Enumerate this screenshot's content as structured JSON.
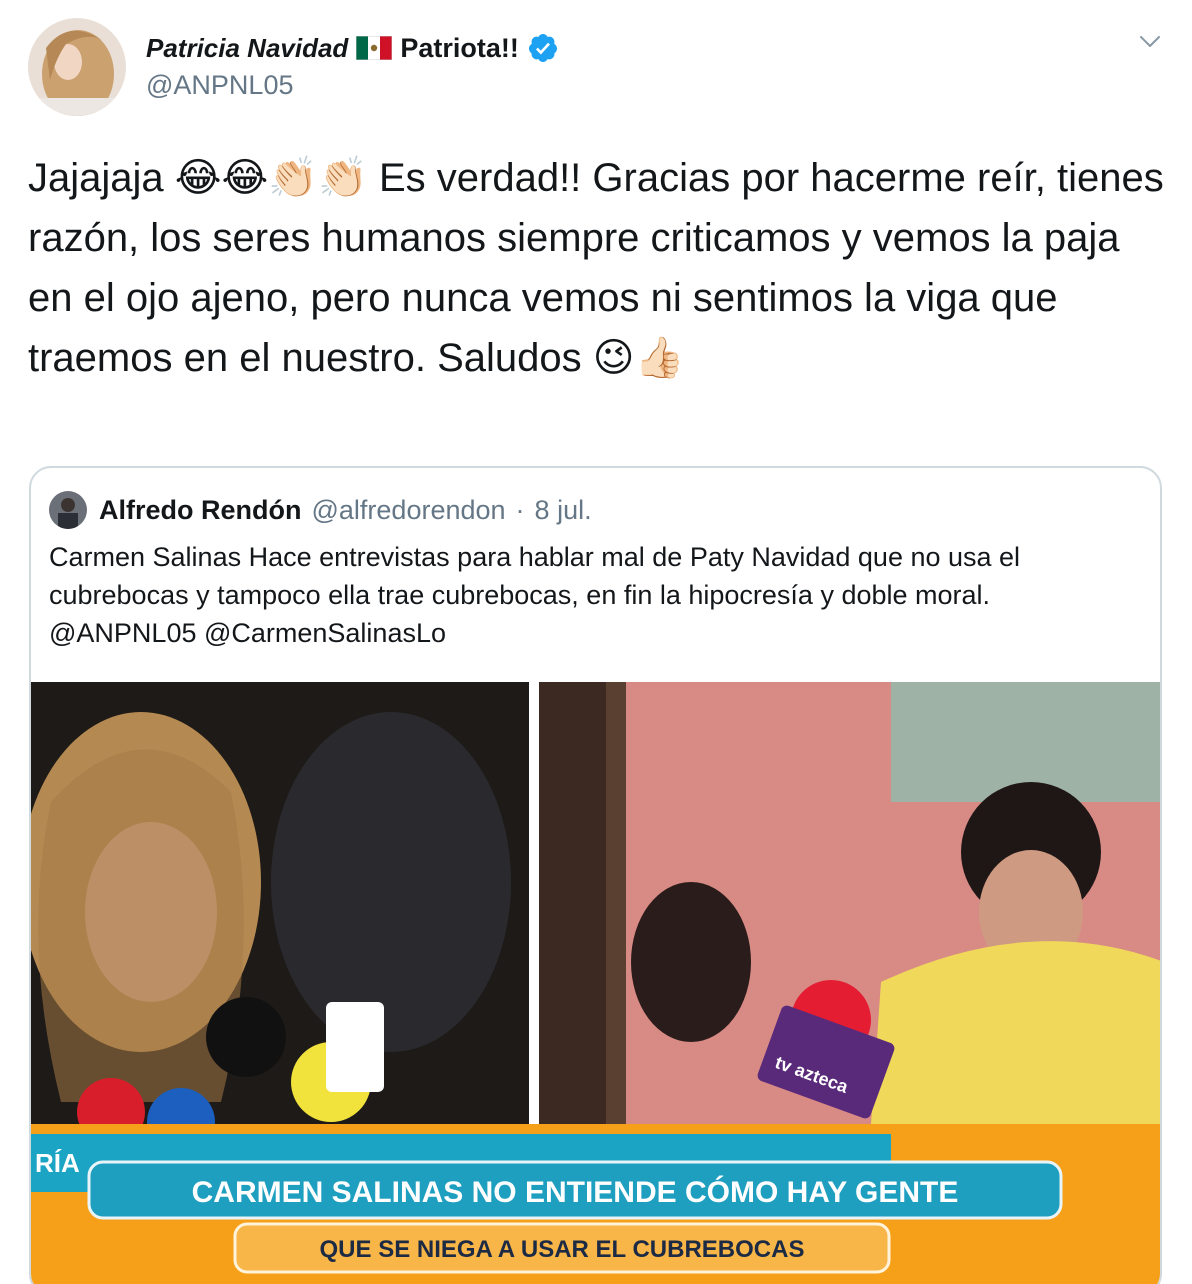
{
  "author": {
    "display_name": "Patricia Navidad",
    "display_name_suffix": "Patriota!!",
    "handle": "@ANPNL05",
    "verified": true,
    "flag": "mexico-flag"
  },
  "tweet": {
    "text_parts": {
      "p1": "Jajajaja ",
      "emojis1": "😂😂👏🏻👏🏻",
      "p2": " Es verdad!! Gracias por hacerme reír, tienes razón, los seres humanos siempre criticamos y vemos la paja en el ojo ajeno, pero nunca vemos ni sentimos la viga que traemos en el nuestro. Saludos ",
      "emojis2": "😉👍🏻"
    }
  },
  "quoted_tweet": {
    "author_name": "Alfredo Rendón",
    "author_handle": "@alfredorendon",
    "separator": "·",
    "date": "8 jul.",
    "text": "Carmen Salinas Hace entrevistas para hablar mal de Paty Navidad que no usa el cubrebocas y tampoco ella trae cubrebocas, en fin la hipocresía y doble moral. @ANPNL05 @CarmenSalinasLo",
    "media": {
      "banner_main": "CARMEN SALINAS NO ENTIENDE CÓMO HAY GENTE",
      "banner_sub": "QUE SE NIEGA A USAR EL CUBREBOCAS",
      "corner_label": "RÍA",
      "logo_text": "tv azteca"
    }
  },
  "colors": {
    "text": "#14171a",
    "secondary": "#657786",
    "verified": "#1da1f2",
    "border": "#cfd9de",
    "banner_orange": "#f6a01a",
    "banner_teal": "#19a6c6"
  }
}
